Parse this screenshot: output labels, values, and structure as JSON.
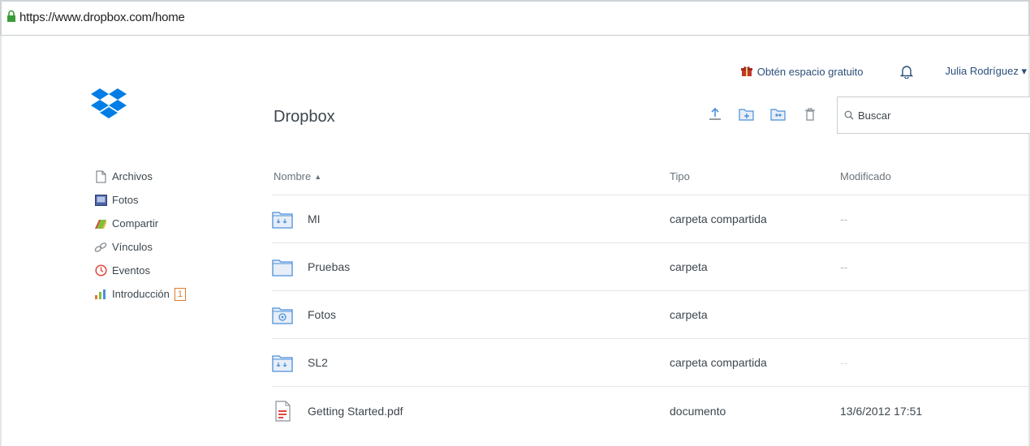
{
  "browser": {
    "url": "https://www.dropbox.com/home"
  },
  "topbar": {
    "free_space_label": "Obtén espacio gratuito",
    "user_name": "Julia Rodríguez ▾"
  },
  "main": {
    "title": "Dropbox"
  },
  "search": {
    "placeholder": "Buscar"
  },
  "sidebar": {
    "items": [
      {
        "label": "Archivos",
        "icon": "file-icon"
      },
      {
        "label": "Fotos",
        "icon": "photos-icon"
      },
      {
        "label": "Compartir",
        "icon": "share-icon"
      },
      {
        "label": "Vínculos",
        "icon": "link-icon"
      },
      {
        "label": "Eventos",
        "icon": "clock-icon"
      },
      {
        "label": "Introducción",
        "icon": "intro-icon",
        "badge": "1"
      }
    ]
  },
  "table": {
    "headers": {
      "name": "Nombre",
      "type": "Tipo",
      "modified": "Modificado"
    },
    "rows": [
      {
        "name": "MI",
        "type": "carpeta compartida",
        "modified": "--",
        "icon": "shared-folder-icon"
      },
      {
        "name": "Pruebas",
        "type": "carpeta",
        "modified": "--",
        "icon": "folder-icon"
      },
      {
        "name": "Fotos",
        "type": "carpeta",
        "modified": "",
        "icon": "photos-folder-icon"
      },
      {
        "name": "SL2",
        "type": "carpeta compartida",
        "modified": "--",
        "icon": "shared-folder-icon"
      },
      {
        "name": "Getting Started.pdf",
        "type": "documento",
        "modified": "13/6/2012 17:51",
        "icon": "pdf-file-icon"
      }
    ]
  },
  "colors": {
    "brand_blue": "#007ee5",
    "link_blue": "#2b4e7a",
    "text": "#3d464d",
    "divider": "#e3e6e9",
    "badge_orange": "#e07a2e"
  }
}
